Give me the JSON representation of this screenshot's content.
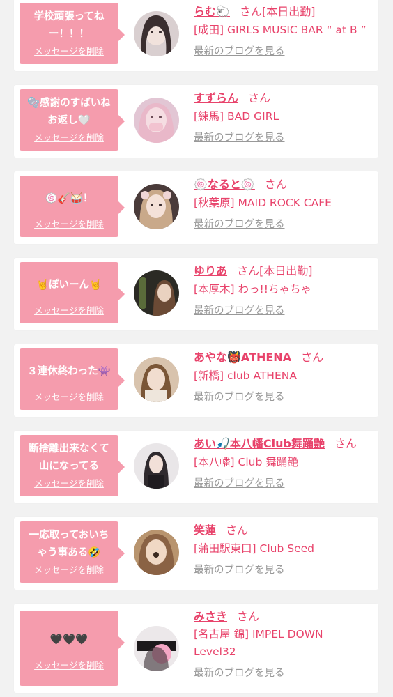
{
  "delete_label": "メッセージを削除",
  "blog_label": "最新のブログを見る",
  "san_label": "さん",
  "colors": {
    "accent": "#e8436b",
    "bubble": "#f59cad",
    "muted": "#999999"
  },
  "cards": [
    {
      "message": "学校頑張ってねー！！！",
      "name": "らむ🐑",
      "status": "[本日出勤]",
      "shop": "[成田] GIRLS MUSIC BAR “ at B ”"
    },
    {
      "message": "🫧感謝のすばいね\nお返し🤍",
      "name": "すずらん",
      "status": "",
      "shop": "[練馬] BAD GIRL"
    },
    {
      "message": "🍥🎸🥁！",
      "name": "🍥なると🍥",
      "status": "",
      "shop": "[秋葉原] MAID ROCK CAFE"
    },
    {
      "message": "🤘ぽいーん🤘",
      "name": "ゆりあ",
      "status": "[本日出勤]",
      "shop": "[本厚木] わっ!!ちゃちゃ"
    },
    {
      "message": "３連休終わった👾",
      "name": "あやな👹ATHENA",
      "status": "",
      "shop": "[新橋] club ATHENA"
    },
    {
      "message": "断捨離出来なくて\n山になってる",
      "name": "あい🎣本八幡Club舞踊艶",
      "status": "",
      "shop": "[本八幡] Club 舞踊艶"
    },
    {
      "message": "一応取っておいち\nゃう事ある🤣",
      "name": "笑蓮",
      "status": "",
      "shop": "[蒲田駅東口] Club Seed"
    },
    {
      "message": "🖤🖤🖤",
      "name": "みさき",
      "status": "",
      "shop": "[名古屋 錦] IMPEL DOWN Level32"
    }
  ]
}
